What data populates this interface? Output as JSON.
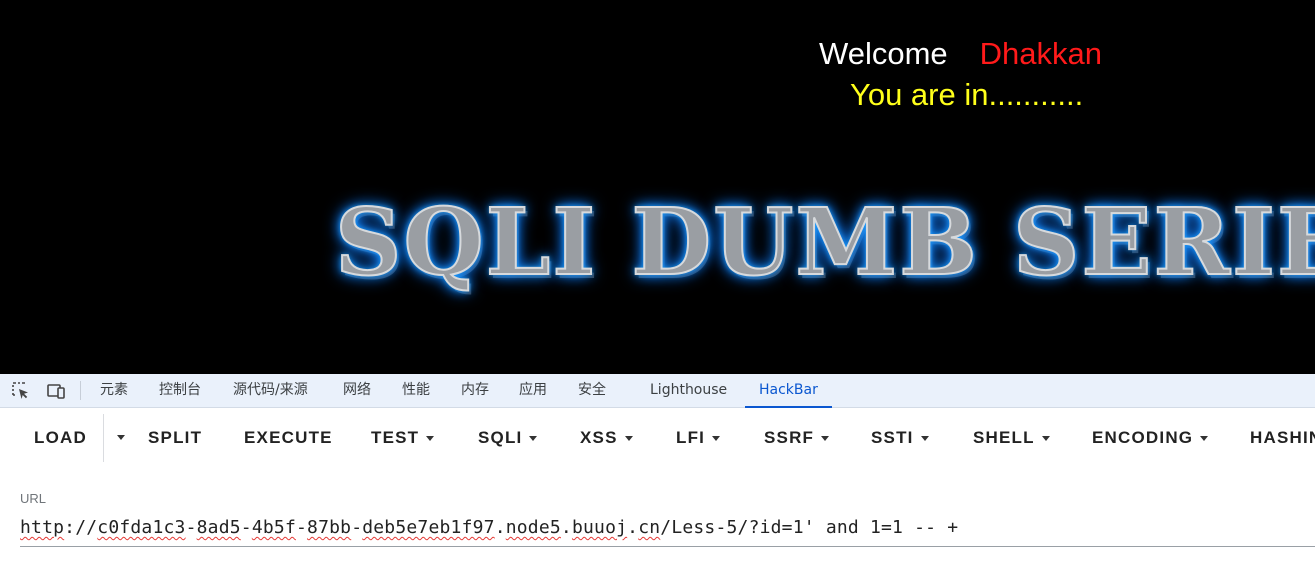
{
  "page": {
    "welcome_text": "Welcome",
    "user_name": "Dhakkan",
    "status_text": "You are in...........",
    "banner_text": "SQLI DUMB SERIES"
  },
  "devtools": {
    "icons": [
      "inspect-element-icon",
      "device-toolbar-icon"
    ],
    "tabs": [
      "元素",
      "控制台",
      "源代码/来源",
      "网络",
      "性能",
      "内存",
      "应用",
      "安全",
      "Lighthouse",
      "HackBar"
    ],
    "active_tab": "HackBar"
  },
  "hackbar": {
    "buttons": [
      "LOAD",
      "SPLIT",
      "EXECUTE",
      "TEST",
      "SQLI",
      "XSS",
      "LFI",
      "SSRF",
      "SSTI",
      "SHELL",
      "ENCODING",
      "HASHIN"
    ],
    "url_label": "URL",
    "url_parts": [
      "http",
      "://",
      "c0fda1c3",
      "-",
      "8ad5",
      "-",
      "4b5f",
      "-",
      "87bb",
      "-",
      "deb5e7eb1f97",
      ".",
      "node5",
      ".",
      "buuoj",
      ".",
      "cn",
      "/Less-5/?id=1' and 1=1 -- +"
    ]
  },
  "colors": {
    "welcome": "#ffffff",
    "user_name": "#ff1a1a",
    "status": "#ffff1a",
    "active_tab": "#0b57d0",
    "tabbar_bg": "#eaf1fb",
    "banner_glow": "#1aa3ff"
  }
}
